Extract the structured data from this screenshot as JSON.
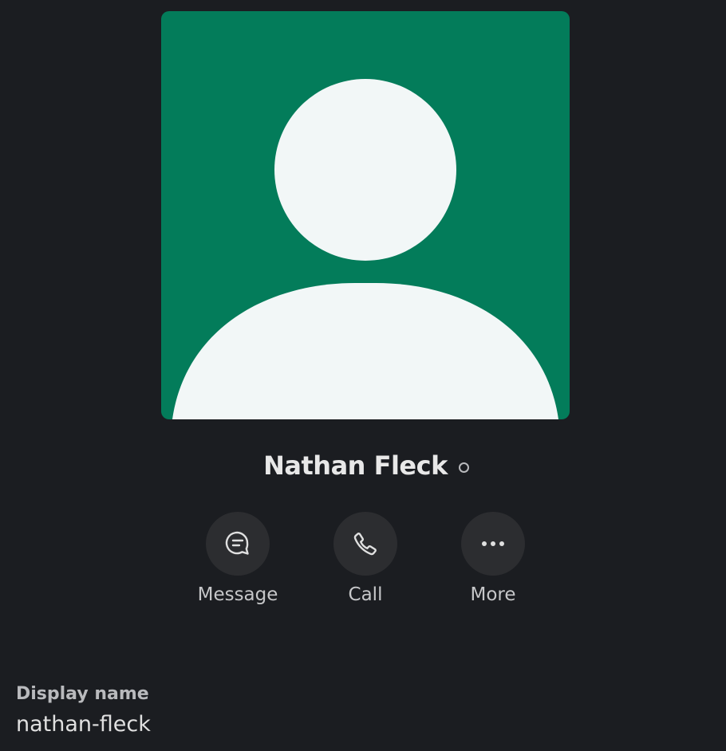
{
  "profile": {
    "name": "Nathan Fleck",
    "presence": "away",
    "avatar_color": "#037c5a",
    "avatar_figure_color": "#f2f7f7"
  },
  "actions": [
    {
      "label": "Message",
      "icon": "message-icon"
    },
    {
      "label": "Call",
      "icon": "phone-icon"
    },
    {
      "label": "More",
      "icon": "more-icon"
    }
  ],
  "fields": {
    "display_name": {
      "label": "Display name",
      "value": "nathan-fleck"
    }
  }
}
